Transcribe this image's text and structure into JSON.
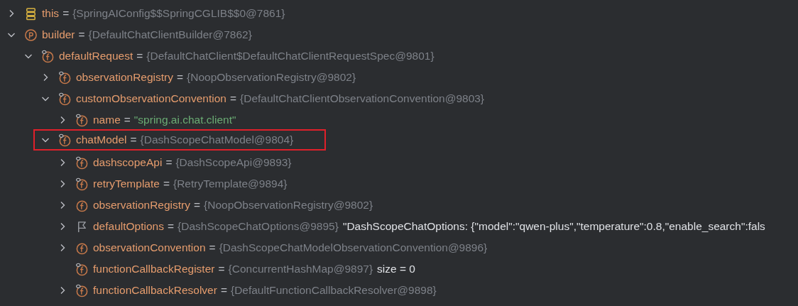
{
  "variables": [
    {
      "kind": "stack",
      "name": "this",
      "eq": "=",
      "value": "{SpringAIConfig$$SpringCGLIB$$0@7861}",
      "expanded": false,
      "highlighted": false
    },
    {
      "kind": "parameter",
      "name": "builder",
      "eq": "=",
      "value": "{DefaultChatClientBuilder@7862}",
      "expanded": true,
      "highlighted": false,
      "children": [
        {
          "kind": "final_field",
          "name": "defaultRequest",
          "eq": "=",
          "value": "{DefaultChatClient$DefaultChatClientRequestSpec@9801}",
          "expanded": true,
          "highlighted": false,
          "children": [
            {
              "kind": "final_field",
              "name": "observationRegistry",
              "eq": "=",
              "value": "{NoopObservationRegistry@9802}",
              "expanded": false,
              "highlighted": false
            },
            {
              "kind": "final_field",
              "name": "customObservationConvention",
              "eq": "=",
              "value": "{DefaultChatClientObservationConvention@9803}",
              "expanded": true,
              "highlighted": false,
              "children": [
                {
                  "kind": "final_field",
                  "name": "name",
                  "eq": "=",
                  "string_value": "\"spring.ai.chat.client\"",
                  "expanded": false,
                  "highlighted": false
                }
              ]
            },
            {
              "kind": "final_field",
              "name": "chatModel",
              "eq": "=",
              "value": "{DashScopeChatModel@9804}",
              "expanded": true,
              "highlighted": true,
              "children": [
                {
                  "kind": "final_field",
                  "name": "dashscopeApi",
                  "eq": "=",
                  "value": "{DashScopeApi@9893}",
                  "expanded": false,
                  "highlighted": false
                },
                {
                  "kind": "final_field",
                  "name": "retryTemplate",
                  "eq": "=",
                  "value": "{RetryTemplate@9894}",
                  "expanded": false,
                  "highlighted": false
                },
                {
                  "kind": "field",
                  "name": "observationRegistry",
                  "eq": "=",
                  "value": "{NoopObservationRegistry@9802}",
                  "expanded": false,
                  "highlighted": false
                },
                {
                  "kind": "flag",
                  "name": "defaultOptions",
                  "eq": "=",
                  "value": "{DashScopeChatOptions@9895}",
                  "extra": "\"DashScopeChatOptions: {\"model\":\"qwen-plus\",\"temperature\":0.8,\"enable_search\":fals",
                  "expanded": false,
                  "highlighted": false
                },
                {
                  "kind": "field",
                  "name": "observationConvention",
                  "eq": "=",
                  "value": "{DashScopeChatModelObservationConvention@9896}",
                  "expanded": false,
                  "highlighted": false
                },
                {
                  "kind": "final_field",
                  "name": "functionCallbackRegister",
                  "eq": "=",
                  "value": "{ConcurrentHashMap@9897}",
                  "extra": "size = 0",
                  "highlighted": false
                },
                {
                  "kind": "final_field",
                  "name": "functionCallbackResolver",
                  "eq": "=",
                  "value": "{DefaultFunctionCallbackResolver@9898}",
                  "expanded": false,
                  "highlighted": false
                }
              ]
            }
          ]
        }
      ]
    }
  ]
}
